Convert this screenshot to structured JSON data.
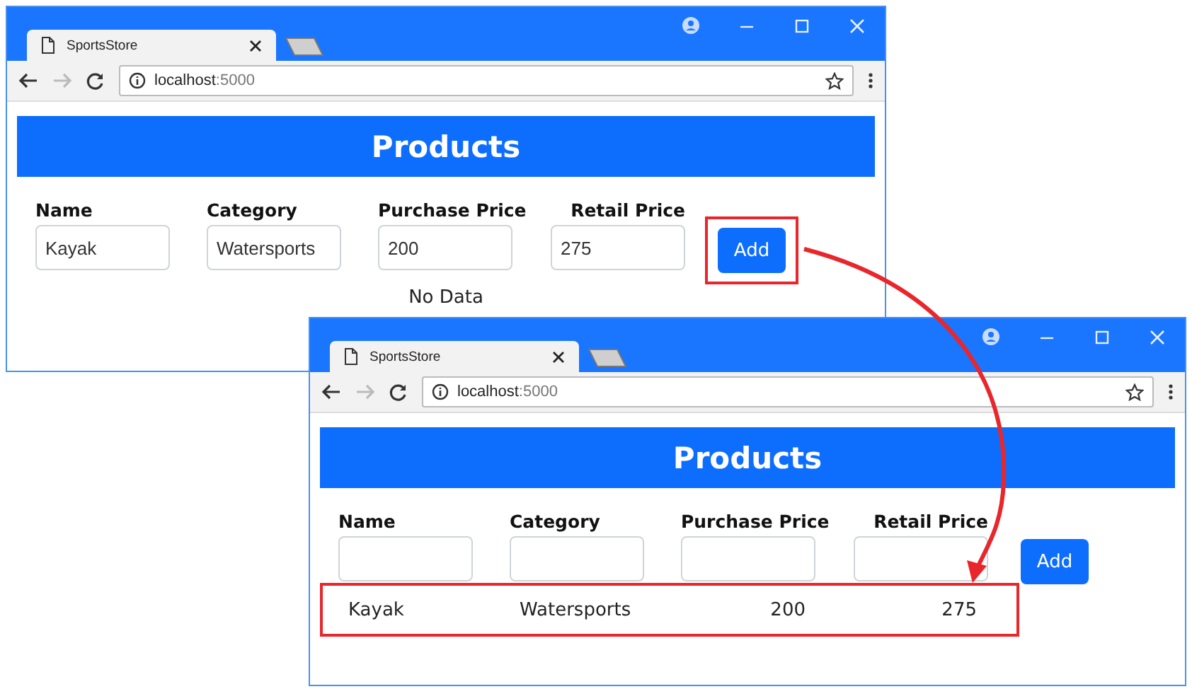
{
  "windows": [
    {
      "tab_title": "SportsStore",
      "url_host": "localhost",
      "url_port": ":5000",
      "heading": "Products",
      "fields": [
        {
          "label": "Name",
          "value": "Kayak"
        },
        {
          "label": "Category",
          "value": "Watersports"
        },
        {
          "label": "Purchase Price",
          "value": "200"
        },
        {
          "label": "Retail Price",
          "value": "275"
        }
      ],
      "button": {
        "label": "Add",
        "highlighted": true
      },
      "message": "No Data"
    },
    {
      "tab_title": "SportsStore",
      "url_host": "localhost",
      "url_port": ":5000",
      "heading": "Products",
      "fields": [
        {
          "label": "Name"
        },
        {
          "label": "Category"
        },
        {
          "label": "Purchase Price"
        },
        {
          "label": "Retail Price"
        }
      ],
      "button": {
        "label": "Add",
        "highlighted": false
      },
      "rows": [
        {
          "highlighted": true,
          "cells": [
            "Kayak",
            "Watersports",
            "200",
            "275"
          ]
        }
      ]
    }
  ]
}
